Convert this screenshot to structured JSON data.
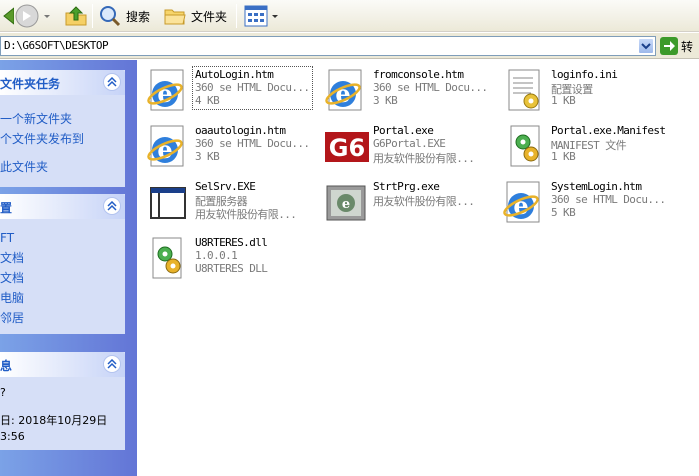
{
  "toolbar": {
    "search_label": "搜索",
    "folders_label": "文件夹"
  },
  "address": {
    "path": "D:\\G6SOFT\\DESKTOP",
    "go_label": "转"
  },
  "tasks_panel": {
    "title": "文件夹任务",
    "items": [
      "一个新文件夹",
      "个文件夹发布到",
      "此文件夹"
    ]
  },
  "places_panel": {
    "title": "置",
    "items": [
      "FT",
      "文档",
      "文档",
      "电脑",
      "邻居"
    ]
  },
  "details_panel": {
    "title": "息",
    "lines": [
      "?",
      "日: 2018年10月29日",
      "3:56"
    ]
  },
  "files": [
    {
      "name": "AutoLogin.htm",
      "type": "360 se HTML Docu...",
      "size": "4 KB",
      "icon": "ie-html-icon"
    },
    {
      "name": "fromconsole.htm",
      "type": "360 se HTML Docu...",
      "size": "3 KB",
      "icon": "ie-html-icon"
    },
    {
      "name": "loginfo.ini",
      "type": "配置设置",
      "size": "1 KB",
      "icon": "ini-config-icon"
    },
    {
      "name": "oaautologin.htm",
      "type": "360 se HTML Docu...",
      "size": "3 KB",
      "icon": "ie-html-icon"
    },
    {
      "name": "Portal.exe",
      "type": "G6Portal.EXE",
      "size": "用友软件股份有限...",
      "icon": "g6-logo-icon"
    },
    {
      "name": "Portal.exe.Manifest",
      "type": "MANIFEST 文件",
      "size": "1 KB",
      "icon": "manifest-gear-icon"
    },
    {
      "name": "SelSrv.EXE",
      "type": "配置服务器",
      "size": "用友软件股份有限...",
      "icon": "window-app-icon"
    },
    {
      "name": "StrtPrg.exe",
      "type": "用友软件股份有限...",
      "size": "",
      "icon": "strtprg-app-icon"
    },
    {
      "name": "SystemLogin.htm",
      "type": "360 se HTML Docu...",
      "size": "5 KB",
      "icon": "ie-html-icon"
    },
    {
      "name": "U8RTERES.dll",
      "type": "1.0.0.1",
      "size": "U8RTERES DLL",
      "icon": "dll-gear-icon"
    }
  ],
  "colors": {
    "task_pane_gradient_start": "#7ba2e7",
    "task_pane_gradient_end": "#6375d6",
    "panel_bg": "#d6dff7",
    "link_color": "#215dc6",
    "secondary_text": "#7a7a7a"
  }
}
